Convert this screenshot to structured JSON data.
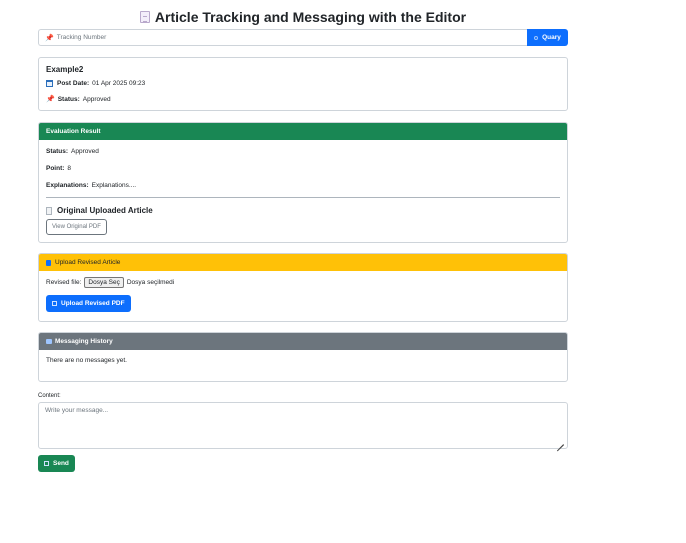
{
  "header": {
    "title": "Article Tracking and Messaging with the Editor"
  },
  "search": {
    "placeholder": "Tracking Number",
    "button_label": "Quary"
  },
  "article": {
    "name": "Example2",
    "post_date_label": "Post Date:",
    "post_date_value": "01 Apr 2025 09:23",
    "status_label": "Status:",
    "status_value": "Approved"
  },
  "evaluation": {
    "header": "Evaluation Result",
    "status_label": "Status:",
    "status_value": "Approved",
    "point_label": "Point:",
    "point_value": "8",
    "explanations_label": "Explanations:",
    "explanations_value": "Explanations....",
    "original_title": "Original Uploaded Article",
    "view_pdf_label": "View Original PDF"
  },
  "upload": {
    "header": "Upload Revised Article",
    "file_label": "Revised file:",
    "choose_button": "Dosya Seç",
    "no_file_text": "Dosya seçilmedi",
    "upload_button": "Upload Revised PDF"
  },
  "messaging": {
    "header": "Messaging History",
    "empty_text": "There are no messages yet."
  },
  "compose": {
    "label": "Content:",
    "placeholder": "Write your message...",
    "send_label": "Send"
  },
  "colors": {
    "success": "#198754",
    "warning": "#ffc107",
    "secondary": "#6c757d",
    "primary": "#0d6efd"
  }
}
